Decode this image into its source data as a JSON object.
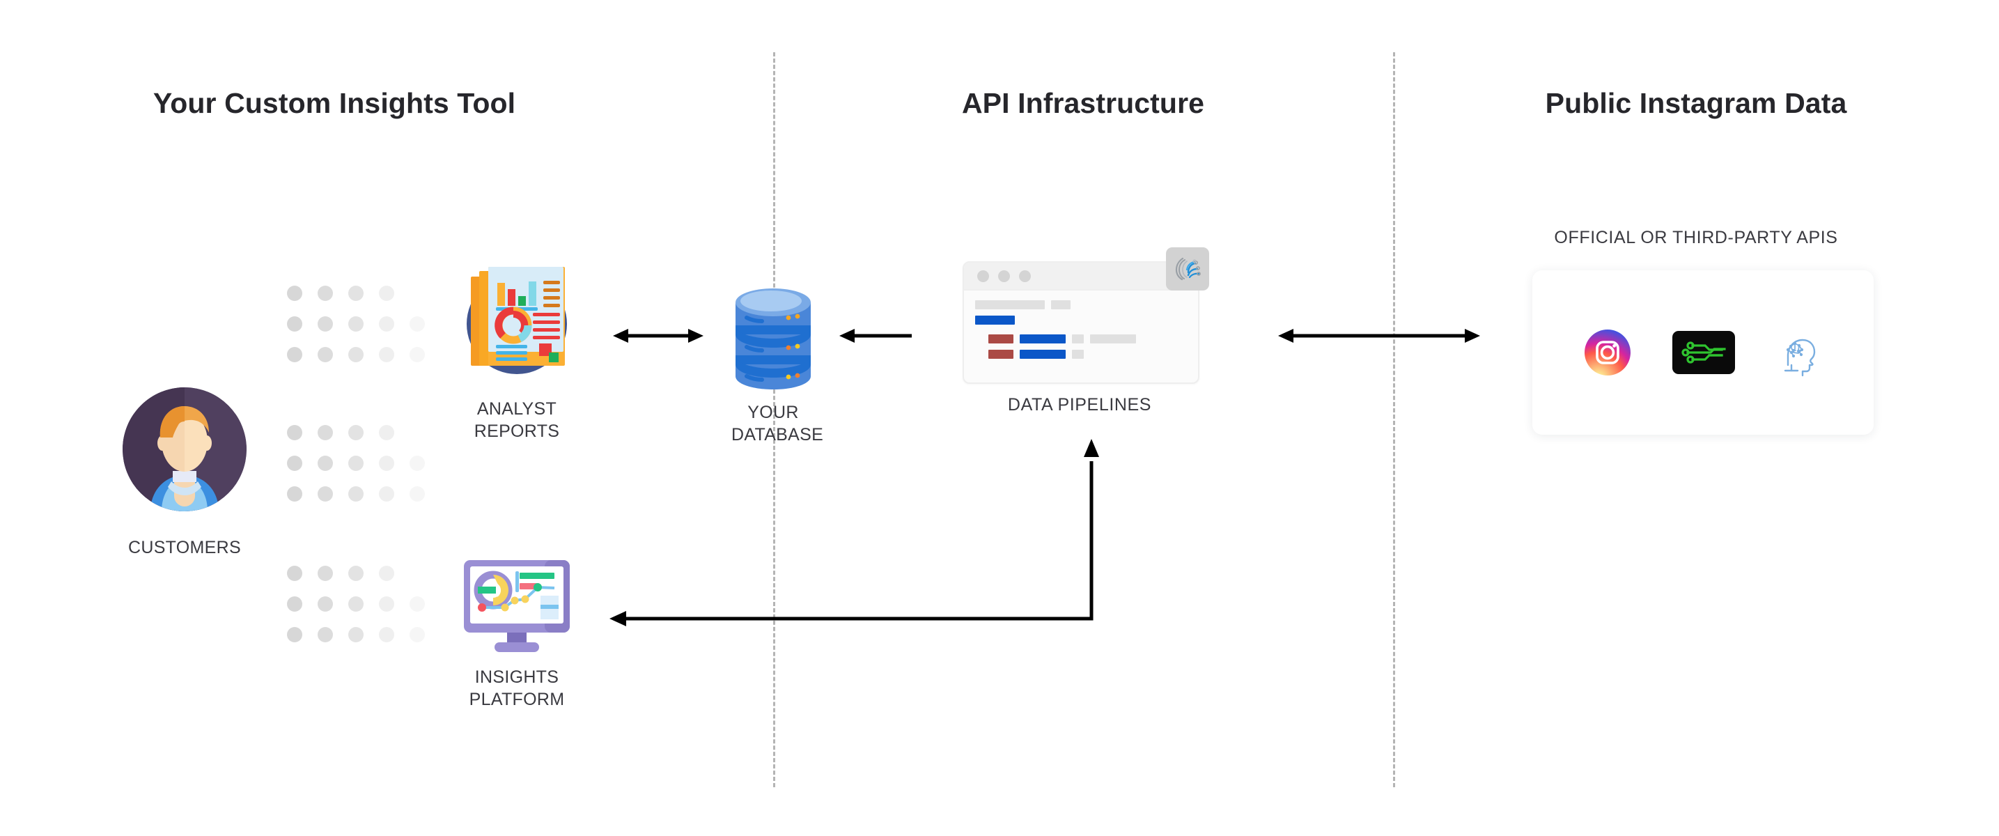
{
  "columns": [
    {
      "title": "Your Custom Insights Tool"
    },
    {
      "title": "API Infrastructure"
    },
    {
      "title": "Public Instagram Data"
    }
  ],
  "nodes": {
    "customers": {
      "label": "CUSTOMERS",
      "icon": "customer-avatar-icon"
    },
    "analyst_reports": {
      "label": "ANALYST\nREPORTS",
      "icon": "analyst-reports-icon"
    },
    "insights_platform": {
      "label": "INSIGHTS\nPLATFORM",
      "icon": "insights-platform-monitor-icon"
    },
    "your_database": {
      "label": "YOUR\nDATABASE",
      "icon": "database-cylinder-icon"
    },
    "data_pipelines": {
      "label": "DATA PIPELINES",
      "icon": "browser-window-icon",
      "badge_icon": "circuit-fingerprint-logo-icon"
    }
  },
  "api_section": {
    "heading": "OFFICIAL OR THIRD-PARTY APIS",
    "logos": [
      {
        "name": "instagram-logo-icon"
      },
      {
        "name": "green-circuit-logo-icon"
      },
      {
        "name": "neural-head-logo-icon"
      }
    ]
  },
  "connectors": [
    {
      "name": "reports-to-database-arrow",
      "direction": "bidirectional"
    },
    {
      "name": "pipelines-to-database-arrow",
      "direction": "left"
    },
    {
      "name": "pipelines-to-apis-arrow",
      "direction": "bidirectional"
    },
    {
      "name": "pipelines-to-insights-feedback-arrow",
      "direction": "left-up"
    }
  ],
  "dividers": [
    {
      "name": "divider-left"
    },
    {
      "name": "divider-right"
    }
  ],
  "colors": {
    "title": "#26262b",
    "caption": "#3a3a40",
    "divider": "#b4b4b4",
    "arrow": "#000000",
    "database_blue": "#4a86d8",
    "reports_circle": "#41558f",
    "monitor_purple": "#8d82c8",
    "circuit_green": "#2fc42f",
    "neural_blue": "#7aaee0"
  }
}
